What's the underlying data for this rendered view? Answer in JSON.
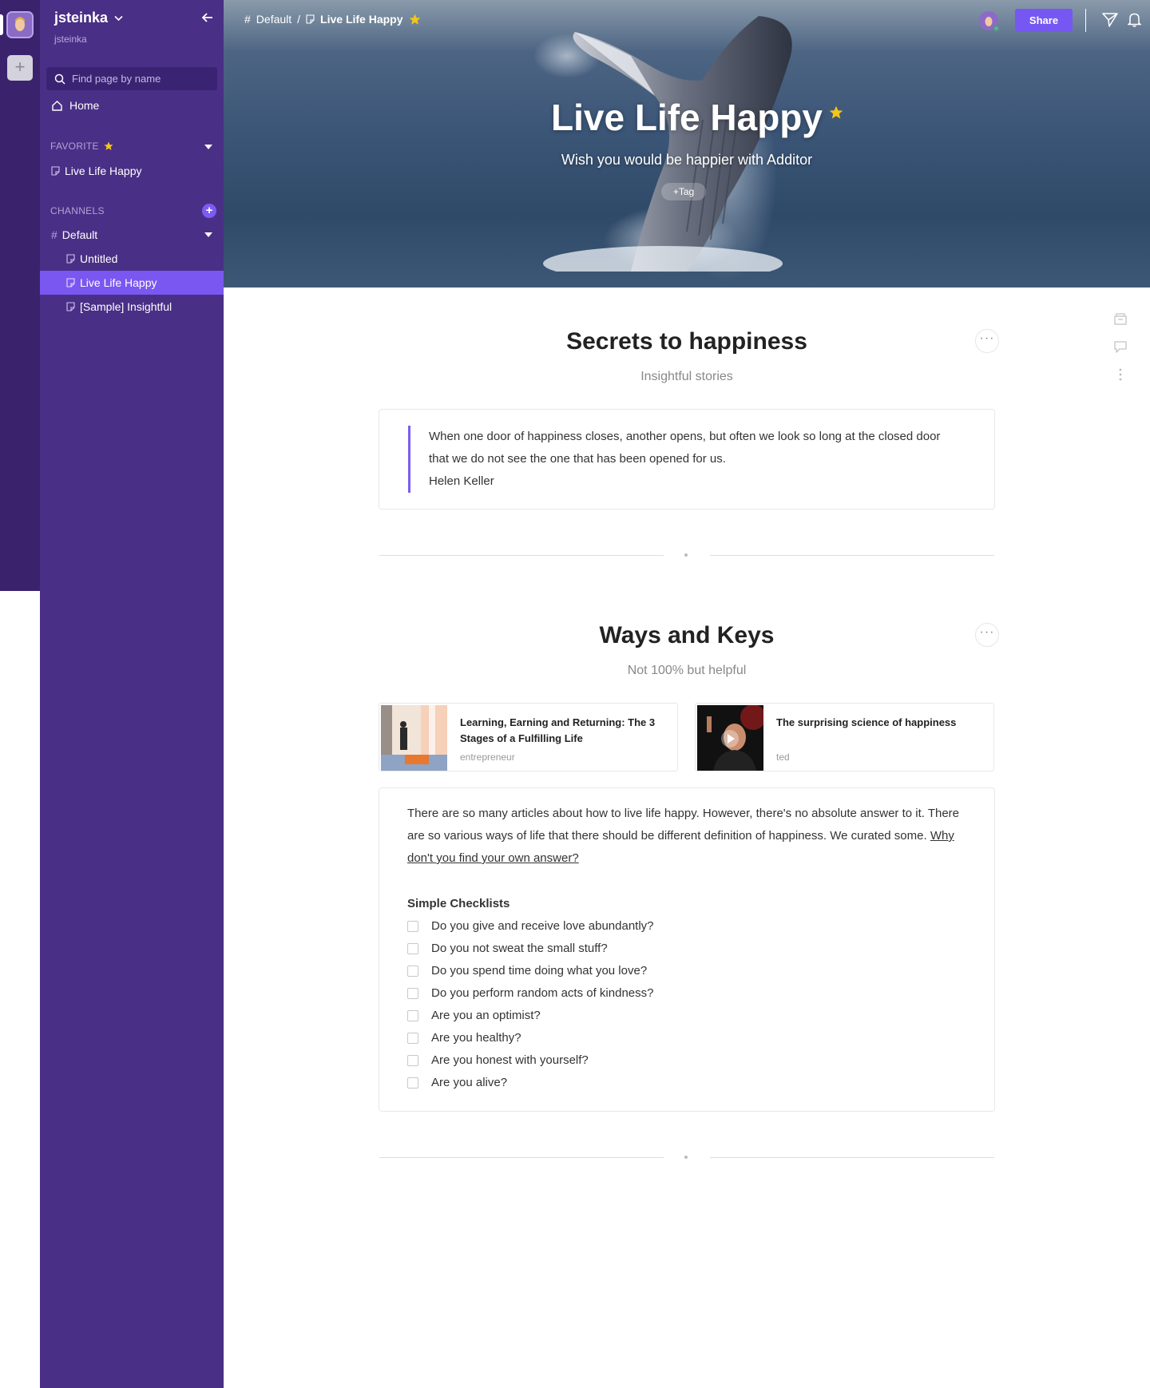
{
  "workspace": {
    "name": "jsteinka",
    "user": "jsteinka"
  },
  "sidebar": {
    "search_placeholder": "Find page by name",
    "home_label": "Home",
    "favorite_heading": "FAVORITE",
    "favorites": [
      {
        "label": "Live Life Happy"
      }
    ],
    "channels_heading": "CHANNELS",
    "channel": {
      "label": "Default"
    },
    "pages": [
      {
        "label": "Untitled",
        "active": false
      },
      {
        "label": "Live Life Happy",
        "active": true
      },
      {
        "label": "[Sample] Insightful",
        "active": false
      }
    ],
    "add_channel_icon": "+"
  },
  "rail": {
    "add_label": "+"
  },
  "topbar": {
    "breadcrumb": {
      "channel": "Default",
      "separator": "/",
      "page": "Live Life Happy"
    },
    "share_label": "Share"
  },
  "cover": {
    "title": "Live Life Happy",
    "subtitle": "Wish you would be happier with Additor",
    "tag_label": "+Tag"
  },
  "block1": {
    "title": "Secrets to happiness",
    "subtitle": "Insightful stories",
    "quote_line1": "When one door of happiness closes, another opens, but often we look so long at the closed door",
    "quote_line2": "that we do not see the one that has been opened for us.",
    "quote_author": "Helen Keller"
  },
  "block2": {
    "title": "Ways and Keys",
    "subtitle": "Not 100% but helpful",
    "links": [
      {
        "title": "Learning, Earning and Returning: The 3 Stages of a Fulfilling Life",
        "source": "entrepreneur"
      },
      {
        "title": "The surprising science of happiness",
        "source": "ted"
      }
    ],
    "para_text": "There are so many articles about how to live life happy. However, there's no absolute answer to it. There are so various ways of life that there should be different definition of happiness. We curated some. ",
    "para_link": "Why don't you find your own answer?",
    "checklist_title": "Simple Checklists",
    "checklist": [
      "Do you give and receive love abundantly?",
      "Do you not sweat the small stuff?",
      "Do you spend time doing what you love?",
      "Do you perform random acts of kindness?",
      "Are you an optimist?",
      "Are you healthy?",
      "Are you honest with yourself?",
      "Are you alive?"
    ]
  },
  "more_label": "···",
  "colors": {
    "sidebar": "#4a2f86",
    "rail": "#3a236c",
    "accent": "#7657f2",
    "star": "#f5c518"
  },
  "icons": [
    "search-icon",
    "home-icon",
    "star-icon",
    "page-icon",
    "hash-icon",
    "arrow-left-icon",
    "send-icon",
    "bell-icon",
    "archive-icon",
    "comment-icon",
    "kebab-icon",
    "play-icon"
  ]
}
